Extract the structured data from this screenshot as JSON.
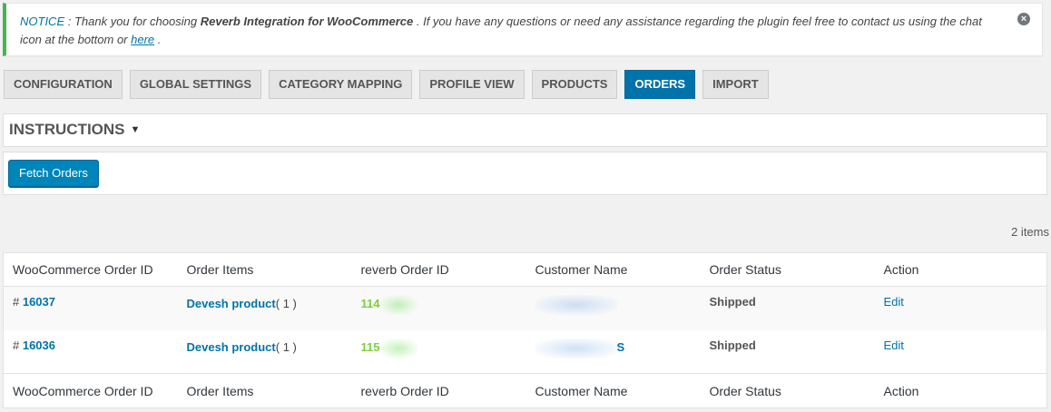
{
  "notice": {
    "label": "NOTICE",
    "text_1": " : Thank you for choosing ",
    "plugin_name": "Reverb Integration for WooCommerce",
    "text_2": " . If you have any questions or need any assistance regarding the plugin feel free to contact us using the chat icon at the bottom or ",
    "link_text": "here",
    "text_3": " .",
    "dismiss_icon": "close-circle-icon"
  },
  "tabs": [
    {
      "label": "CONFIGURATION"
    },
    {
      "label": "GLOBAL SETTINGS"
    },
    {
      "label": "CATEGORY MAPPING"
    },
    {
      "label": "PROFILE VIEW"
    },
    {
      "label": "PRODUCTS"
    },
    {
      "label": "ORDERS"
    },
    {
      "label": "IMPORT"
    }
  ],
  "active_tab": "ORDERS",
  "instructions": {
    "title": "INSTRUCTIONS",
    "caret": "▼"
  },
  "fetch_button": "Fetch Orders",
  "item_count": "2 items",
  "table": {
    "columns": [
      "WooCommerce Order ID",
      "Order Items",
      "reverb Order ID",
      "Customer Name",
      "Order Status",
      "Action"
    ],
    "rows": [
      {
        "hash": "# ",
        "order_id": "16037",
        "item_name": "Devesh product",
        "item_qty": "( 1 )",
        "reverb_id_visible": "114",
        "customer_visible": "",
        "status": "Shipped",
        "action": "Edit"
      },
      {
        "hash": "# ",
        "order_id": "16036",
        "item_name": "Devesh product",
        "item_qty": "( 1 )",
        "reverb_id_visible": "115",
        "customer_visible": "S",
        "status": "Shipped",
        "action": "Edit"
      }
    ]
  },
  "colors": {
    "accent": "#0073aa",
    "notice_border": "#46b450",
    "reverb_id": "#7ad03a"
  }
}
